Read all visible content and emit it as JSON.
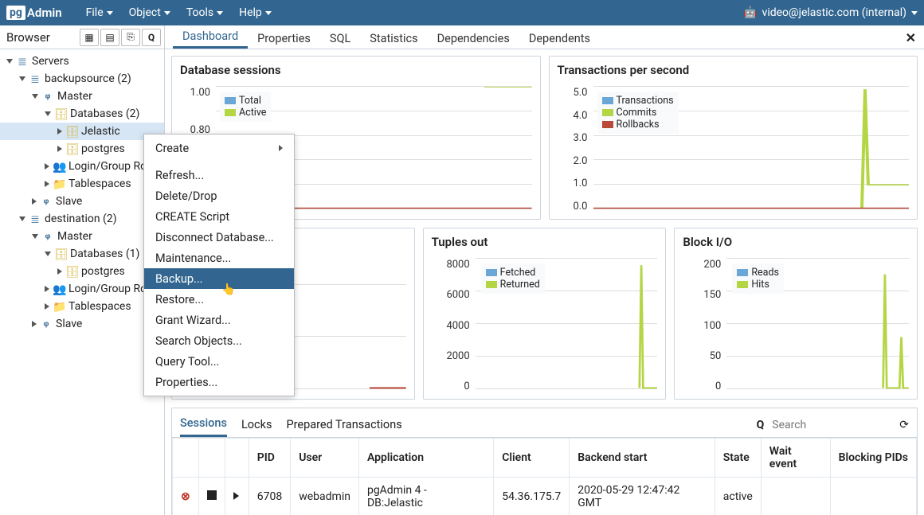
{
  "topbar": {
    "logo_pg": "pg",
    "logo_admin": "Admin",
    "menus": [
      "File",
      "Object",
      "Tools",
      "Help"
    ],
    "user": "video@jelastic.com (internal)"
  },
  "browser": {
    "title": "Browser"
  },
  "tabs": [
    "Dashboard",
    "Properties",
    "SQL",
    "Statistics",
    "Dependencies",
    "Dependents"
  ],
  "tree": {
    "servers": "Servers",
    "backupsource": "backupsource (2)",
    "master": "Master",
    "databases2": "Databases (2)",
    "jelastic": "Jelastic",
    "postgres": "postgres",
    "login_roles": "Login/Group Roles",
    "tablespaces": "Tablespaces",
    "slave": "Slave",
    "destination": "destination (2)",
    "databases1": "Databases (1)"
  },
  "context_menu": {
    "create": "Create",
    "refresh": "Refresh...",
    "delete": "Delete/Drop",
    "create_script": "CREATE Script",
    "disconnect": "Disconnect Database...",
    "maintenance": "Maintenance...",
    "backup": "Backup...",
    "restore": "Restore...",
    "grant": "Grant Wizard...",
    "search_obj": "Search Objects...",
    "query_tool": "Query Tool...",
    "properties": "Properties..."
  },
  "chart_data": [
    {
      "title": "Database sessions",
      "type": "line",
      "y_ticks": [
        "1.00",
        "0.80"
      ],
      "series": [
        {
          "name": "Total",
          "color": "#6aa6d6"
        },
        {
          "name": "Active",
          "color": "#b4d645"
        }
      ]
    },
    {
      "title": "Transactions per second",
      "type": "line",
      "y_ticks": [
        "5.0",
        "4.0",
        "3.0",
        "2.0",
        "1.0",
        "0.0"
      ],
      "series": [
        {
          "name": "Transactions",
          "color": "#6aa6d6"
        },
        {
          "name": "Commits",
          "color": "#b4d645"
        },
        {
          "name": "Rollbacks",
          "color": "#b94a3a"
        }
      ]
    },
    {
      "title": "Tuples out",
      "type": "line",
      "y_ticks": [
        "8000",
        "6000",
        "4000",
        "2000",
        "0"
      ],
      "series": [
        {
          "name": "Fetched",
          "color": "#6aa6d6"
        },
        {
          "name": "Returned",
          "color": "#b4d645"
        }
      ]
    },
    {
      "title": "Block I/O",
      "type": "line",
      "y_ticks": [
        "200",
        "150",
        "100",
        "50",
        "0"
      ],
      "series": [
        {
          "name": "Reads",
          "color": "#6aa6d6"
        },
        {
          "name": "Hits",
          "color": "#b4d645"
        }
      ]
    }
  ],
  "activity": {
    "tabs": [
      "Sessions",
      "Locks",
      "Prepared Transactions"
    ],
    "search_placeholder": "Search",
    "columns": [
      "PID",
      "User",
      "Application",
      "Client",
      "Backend start",
      "State",
      "Wait event",
      "Blocking PIDs"
    ],
    "row": {
      "pid": "6708",
      "user": "webadmin",
      "application": "pgAdmin 4 - DB:Jelastic",
      "client": "54.36.175.7",
      "backend_start": "2020-05-29 12:47:42 GMT",
      "state": "active",
      "wait_event": "",
      "blocking": ""
    }
  }
}
